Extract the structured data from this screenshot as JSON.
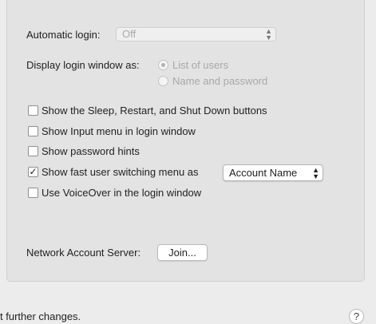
{
  "automatic_login": {
    "label": "Automatic login:",
    "value": "Off"
  },
  "display_login_window": {
    "label": "Display login window as:",
    "options": [
      {
        "label": "List of users",
        "selected": true
      },
      {
        "label": "Name and password",
        "selected": false
      }
    ]
  },
  "checkboxes": [
    {
      "label": "Show the Sleep, Restart, and Shut Down buttons",
      "checked": false
    },
    {
      "label": "Show Input menu in login window",
      "checked": false
    },
    {
      "label": "Show password hints",
      "checked": false
    },
    {
      "label": "Show fast user switching menu as",
      "checked": true
    },
    {
      "label": "Use VoiceOver in the login window",
      "checked": false
    }
  ],
  "fast_user_switching_menu": {
    "value": "Account Name"
  },
  "network_account_server": {
    "label": "Network Account Server:",
    "button_label": "Join..."
  },
  "footer": {
    "lock_text": "t further changes.",
    "help_label": "?"
  }
}
